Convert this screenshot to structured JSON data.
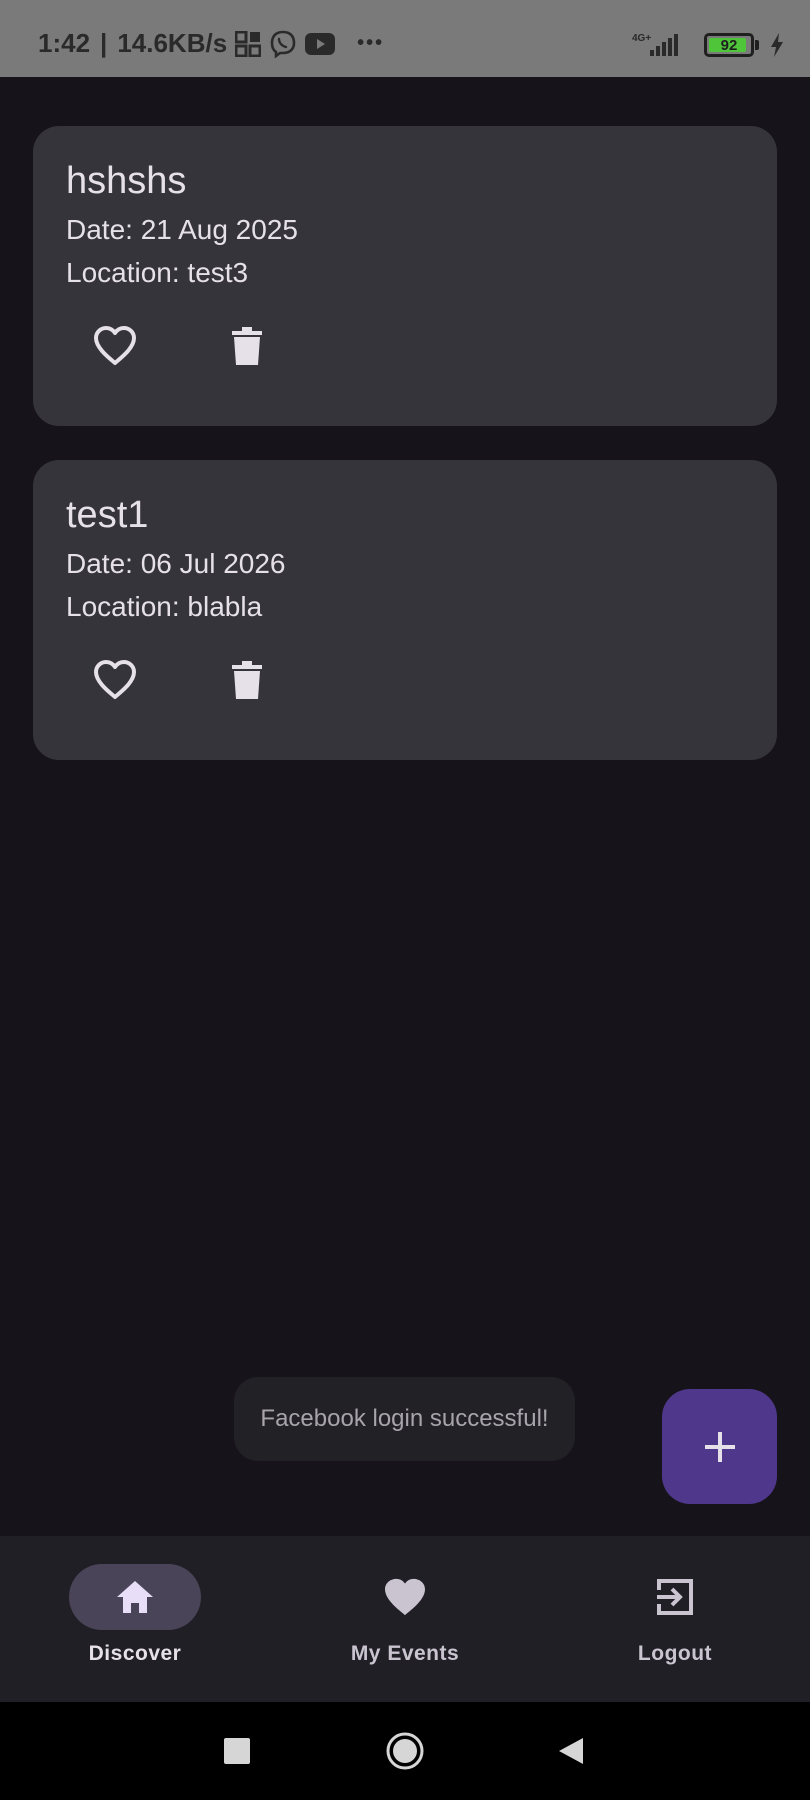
{
  "status_bar": {
    "time": "1:42",
    "separator": "|",
    "speed": "14.6KB/s",
    "more": "•••",
    "network": "4G+",
    "battery_level": "92",
    "battery_fraction": 0.92,
    "icons": [
      "qr-icon",
      "viber-icon",
      "youtube-icon",
      "signal-icon",
      "battery-icon",
      "charging-icon"
    ]
  },
  "events": [
    {
      "title": "hshshs",
      "date": "Date: 21 Aug 2025",
      "location": "Location: test3"
    },
    {
      "title": "test1",
      "date": "Date: 06 Jul 2026",
      "location": "Location: blabla"
    }
  ],
  "toast": {
    "message": "Facebook login successful!"
  },
  "fab": {
    "icon": "plus-icon"
  },
  "bottom_nav": {
    "items": [
      {
        "label": "Discover",
        "icon": "home-icon",
        "active": true
      },
      {
        "label": "My Events",
        "icon": "heart-icon",
        "active": false
      },
      {
        "label": "Logout",
        "icon": "logout-icon",
        "active": false
      }
    ]
  },
  "colors": {
    "background": "#16141a",
    "card": "#36343b",
    "fab": "#4f378b",
    "nav_active_pill": "#4a4458",
    "text_primary": "#e6e0e9"
  }
}
